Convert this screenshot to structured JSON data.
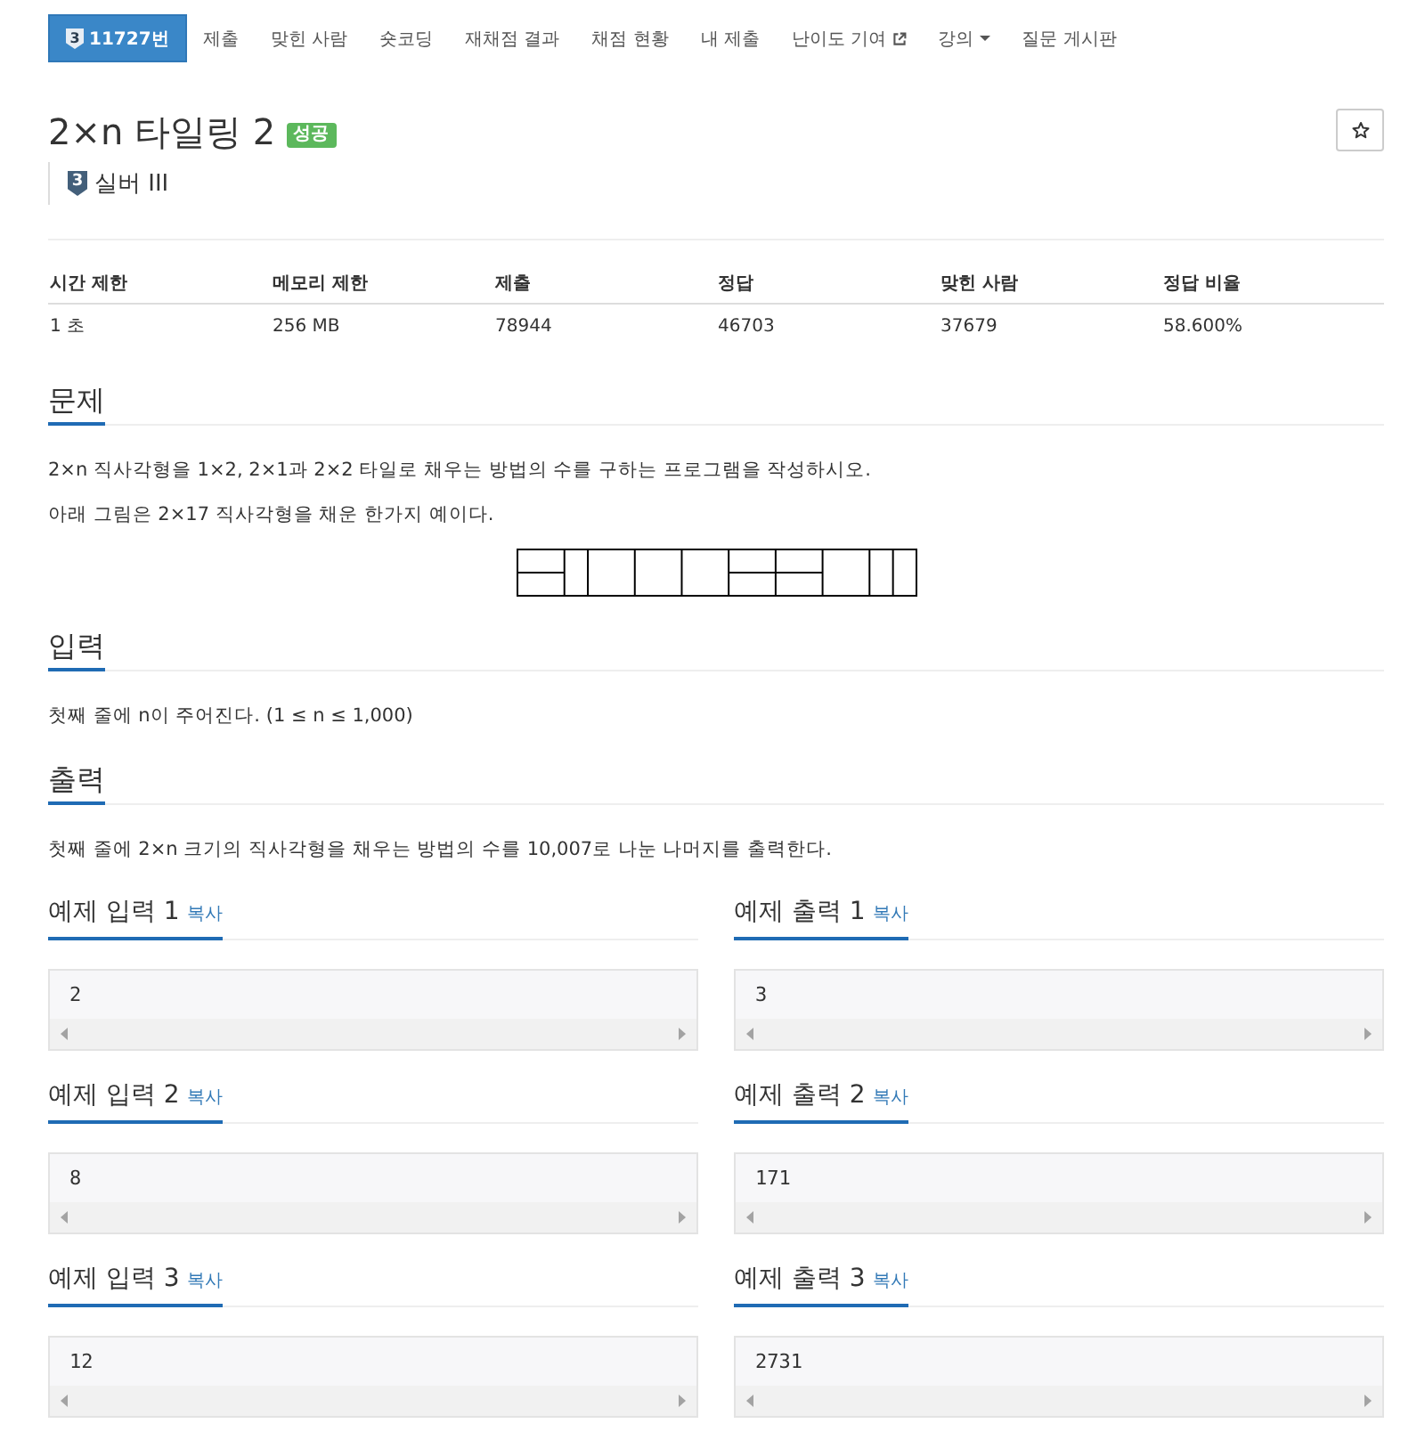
{
  "nav": {
    "tabs": [
      {
        "kind": "problem",
        "badge": "3",
        "label": "11727번",
        "selected": true
      },
      {
        "kind": "link",
        "label": "제출",
        "selected": false
      },
      {
        "kind": "link",
        "label": "맞힌 사람",
        "selected": false
      },
      {
        "kind": "link",
        "label": "숏코딩",
        "selected": false
      },
      {
        "kind": "link",
        "label": "재채점 결과",
        "selected": false
      },
      {
        "kind": "link",
        "label": "채점 현황",
        "selected": false
      },
      {
        "kind": "link",
        "label": "내 제출",
        "selected": false
      },
      {
        "kind": "external",
        "label": "난이도 기여",
        "selected": false
      },
      {
        "kind": "dropdown",
        "label": "강의",
        "selected": false
      },
      {
        "kind": "link",
        "label": "질문 게시판",
        "selected": false
      }
    ]
  },
  "problem": {
    "title": "2×n 타일링 2",
    "result_badge": "성공",
    "tier": {
      "badge": "3",
      "name": "실버 III"
    }
  },
  "stats": {
    "columns": [
      "시간 제한",
      "메모리 제한",
      "제출",
      "정답",
      "맞힌 사람",
      "정답 비율"
    ],
    "rows": [
      [
        "1 초",
        "256 MB",
        "78944",
        "46703",
        "37679",
        "58.600%"
      ]
    ]
  },
  "sections": [
    {
      "title": "문제",
      "content": [
        {
          "kind": "text",
          "text": "2×n 직사각형을 1×2, 2×1과 2×2 타일로 채우는 방법의 수를 구하는 프로그램을 작성하시오."
        },
        {
          "kind": "text",
          "text": "아래 그림은 2×17 직사각형을 채운 한가지 예이다."
        },
        {
          "kind": "figure"
        }
      ]
    },
    {
      "title": "입력",
      "content": [
        {
          "kind": "text",
          "text": "첫째 줄에 n이 주어진다. (1 ≤ n ≤ 1,000)"
        }
      ]
    },
    {
      "title": "출력",
      "content": [
        {
          "kind": "text",
          "text": "첫째 줄에 2×n 크기의 직사각형을 채우는 방법의 수를 10,007로 나눈 나머지를 출력한다."
        }
      ]
    }
  ],
  "samples": [
    {
      "title": "예제 입력 1",
      "copy": "복사",
      "value": "2"
    },
    {
      "title": "예제 출력 1",
      "copy": "복사",
      "value": "3"
    },
    {
      "title": "예제 입력 2",
      "copy": "복사",
      "value": "8"
    },
    {
      "title": "예제 출력 2",
      "copy": "복사",
      "value": "171"
    },
    {
      "title": "예제 입력 3",
      "copy": "복사",
      "value": "12"
    },
    {
      "title": "예제 출력 3",
      "copy": "복사",
      "value": "2731"
    }
  ]
}
